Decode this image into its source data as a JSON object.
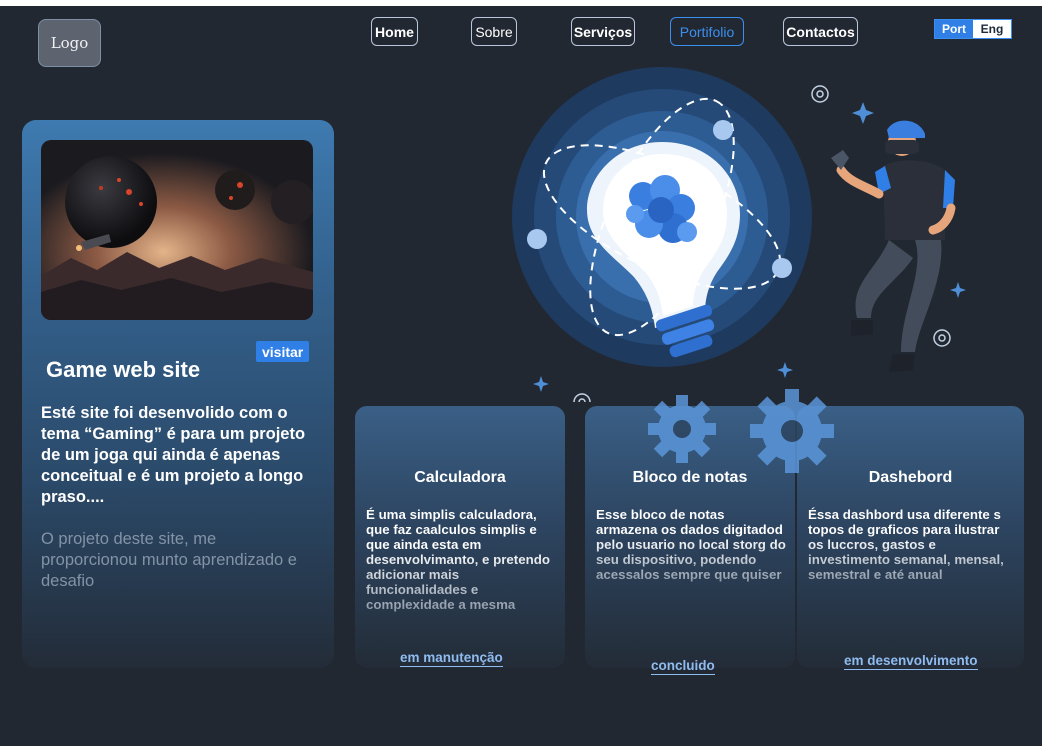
{
  "header": {
    "logo": "Logo",
    "nav": [
      "Home",
      "Sobre",
      "Serviços",
      "Portifolio",
      "Contactos"
    ],
    "active_nav": "Portifolio",
    "languages": [
      "Port",
      "Eng"
    ],
    "active_language": "Port"
  },
  "featured": {
    "visit_label": "visitar",
    "title": "Game web site",
    "description": "Esté site foi desenvolido com o tema “Gaming” é para um projeto de um joga qui ainda é apenas conceitual e é um projeto a longo praso....",
    "note": "O projeto deste site, me proporcionou munto aprendizado e desafio"
  },
  "projects": [
    {
      "title": "Calculadora",
      "description": "É uma simplis calculadora, que faz caalculos simplis  e  que ainda esta em desenvolvimanto, e pretendo adicionar mais funcionalidades e complexidade a mesma",
      "status": "em manutenção"
    },
    {
      "title": "Bloco de notas",
      "description": "Esse bloco de notas armazena os dados digitadod pelo usuario no local storg do seu dispositivo, podendo acessalos sempre que quiser",
      "status": "concluido"
    },
    {
      "title": "Dashebord",
      "description": "Éssa dashbord usa diferente s topos de graficos para ilustrar os luccros, gastos e investimento semanal, mensal, semestral e até anual",
      "status": "em desenvolvimento"
    }
  ],
  "colors": {
    "background": "#222831",
    "accent": "#2f7fe6",
    "status_link": "#8fbcf0"
  },
  "icons": [
    "gear-icon",
    "sparkle-icon",
    "lightbulb-illustration",
    "vr-person-illustration"
  ]
}
